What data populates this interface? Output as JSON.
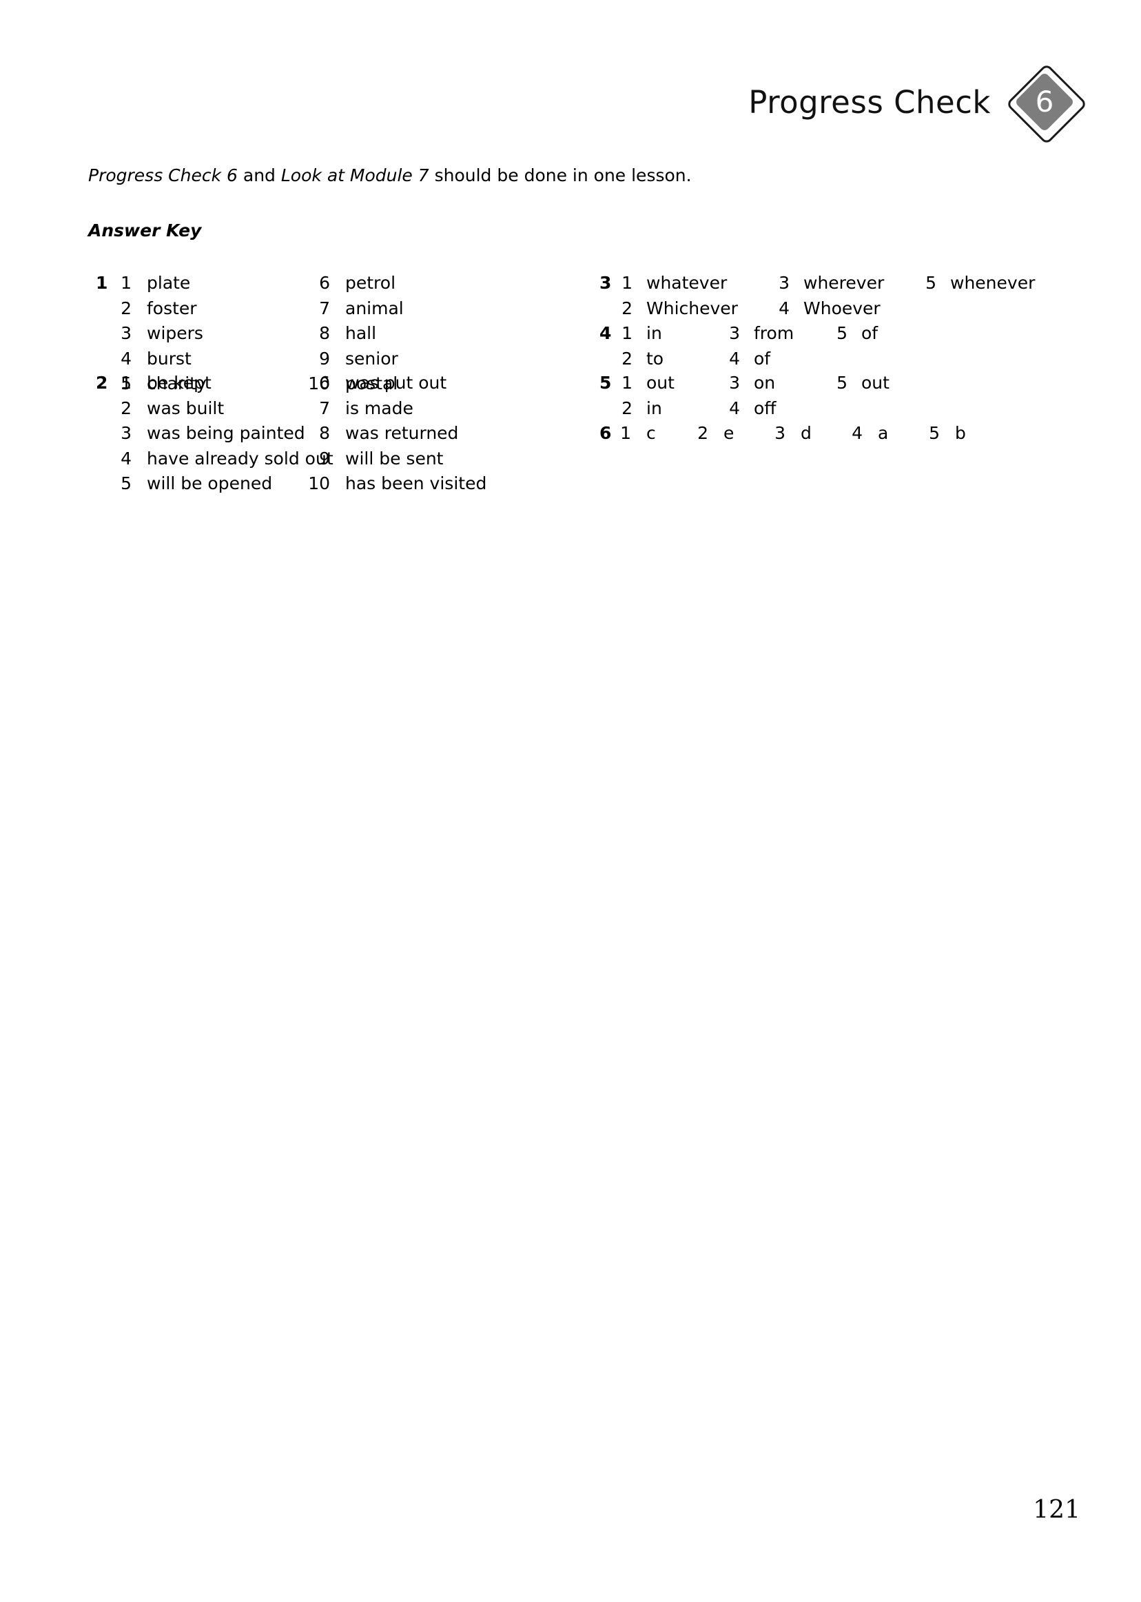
{
  "header": {
    "title": "Progress Check",
    "badge_number": "6",
    "badge_fill_color": "#7d7d7d",
    "badge_border_color": "#1a1a1a"
  },
  "intro_note": {
    "segment_1_italic": "Progress Check 6",
    "segment_2": " and ",
    "segment_3_italic": "Look at Module 7",
    "segment_4": " should be done in one lesson."
  },
  "answer_key_heading": "Answer Key",
  "exercises": [
    {
      "number": "1",
      "layout": "two-column",
      "rows": [
        {
          "left": {
            "num": "1",
            "text": "plate"
          },
          "right": {
            "num": "6",
            "text": "petrol"
          }
        },
        {
          "left": {
            "num": "2",
            "text": "foster"
          },
          "right": {
            "num": "7",
            "text": "animal"
          }
        },
        {
          "left": {
            "num": "3",
            "text": "wipers"
          },
          "right": {
            "num": "8",
            "text": "hall"
          }
        },
        {
          "left": {
            "num": "4",
            "text": "burst"
          },
          "right": {
            "num": "9",
            "text": "senior"
          }
        },
        {
          "left": {
            "num": "5",
            "text": "charity"
          },
          "right": {
            "num": "10",
            "text": "postal"
          }
        }
      ]
    },
    {
      "number": "2",
      "layout": "two-column",
      "rows": [
        {
          "left": {
            "num": "1",
            "text": "be kept"
          },
          "right": {
            "num": "6",
            "text": "was put out"
          }
        },
        {
          "left": {
            "num": "2",
            "text": "was built"
          },
          "right": {
            "num": "7",
            "text": "is made"
          }
        },
        {
          "left": {
            "num": "3",
            "text": "was being painted"
          },
          "right": {
            "num": "8",
            "text": "was returned"
          }
        },
        {
          "left": {
            "num": "4",
            "text": "have already sold out"
          },
          "right": {
            "num": "9",
            "text": "will be sent"
          }
        },
        {
          "left": {
            "num": "5",
            "text": "will be opened"
          },
          "right": {
            "num": "10",
            "text": "has been visited"
          }
        }
      ]
    },
    {
      "number": "3",
      "layout": "three-column",
      "rows": [
        [
          {
            "num": "1",
            "text": "whatever"
          },
          {
            "num": "3",
            "text": "wherever"
          },
          {
            "num": "5",
            "text": "whenever"
          }
        ],
        [
          {
            "num": "2",
            "text": "Whichever"
          },
          {
            "num": "4",
            "text": "Whoever"
          }
        ]
      ]
    },
    {
      "number": "4",
      "layout": "three-column",
      "rows": [
        [
          {
            "num": "1",
            "text": "in"
          },
          {
            "num": "3",
            "text": "from"
          },
          {
            "num": "5",
            "text": "of"
          }
        ],
        [
          {
            "num": "2",
            "text": "to"
          },
          {
            "num": "4",
            "text": "of"
          }
        ]
      ]
    },
    {
      "number": "5",
      "layout": "three-column",
      "rows": [
        [
          {
            "num": "1",
            "text": "out"
          },
          {
            "num": "3",
            "text": "on"
          },
          {
            "num": "5",
            "text": "out"
          }
        ],
        [
          {
            "num": "2",
            "text": "in"
          },
          {
            "num": "4",
            "text": "off"
          }
        ]
      ]
    },
    {
      "number": "6",
      "layout": "matching-row",
      "rows": [
        [
          {
            "num": "1",
            "text": "c"
          },
          {
            "num": "2",
            "text": "e"
          },
          {
            "num": "3",
            "text": "d"
          },
          {
            "num": "4",
            "text": "a"
          },
          {
            "num": "5",
            "text": "b"
          }
        ]
      ]
    }
  ],
  "page_number": "121"
}
